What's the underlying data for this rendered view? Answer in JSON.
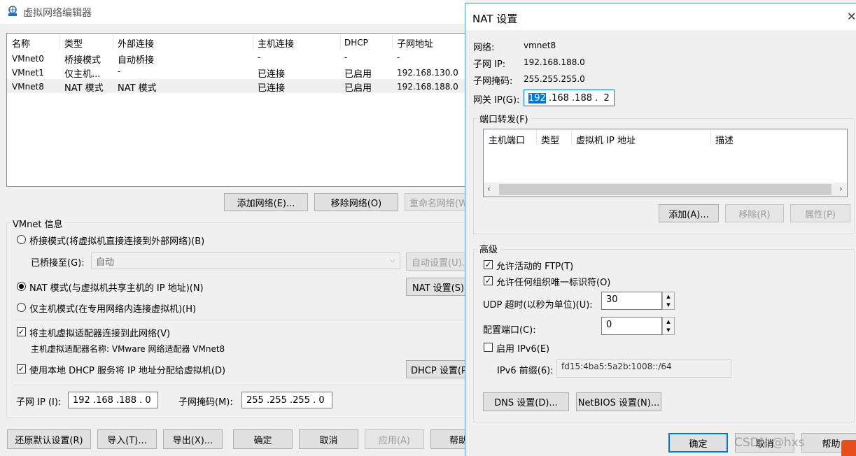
{
  "main_window": {
    "title": "虚拟网络编辑器",
    "table": {
      "columns": [
        "名称",
        "类型",
        "外部连接",
        "主机连接",
        "DHCP",
        "子网地址"
      ],
      "rows": [
        {
          "name": "VMnet0",
          "type": "桥接模式",
          "external": "自动桥接",
          "host": "-",
          "dhcp": "-",
          "subnet": "-"
        },
        {
          "name": "VMnet1",
          "type": "仅主机...",
          "external": "-",
          "host": "已连接",
          "dhcp": "已启用",
          "subnet": "192.168.130.0"
        },
        {
          "name": "VMnet8",
          "type": "NAT 模式",
          "external": "NAT 模式",
          "host": "已连接",
          "dhcp": "已启用",
          "subnet": "192.168.188.0"
        }
      ]
    },
    "buttons": {
      "add_network": "添加网络(E)...",
      "remove_network": "移除网络(O)",
      "rename_network": "重命名网络(W)..."
    },
    "vmnet_info": {
      "title": "VMnet 信息",
      "bridge_mode": "桥接模式(将虚拟机直接连接到外部网络)(B)",
      "bridged_to_label": "已桥接至(G):",
      "bridged_to_value": "自动",
      "auto_settings": "自动设置(U)...",
      "nat_mode": "NAT 模式(与虚拟机共享主机的 IP 地址)(N)",
      "nat_settings": "NAT 设置(S)...",
      "host_only": "仅主机模式(在专用网络内连接虚拟机)(H)",
      "connect_adapter": "将主机虚拟适配器连接到此网络(V)",
      "adapter_name": "主机虚拟适配器名称: VMware 网络适配器 VMnet8",
      "use_dhcp": "使用本地 DHCP 服务将 IP 地址分配给虚拟机(D)",
      "dhcp_settings": "DHCP 设置(P)...",
      "subnet_ip_label": "子网 IP (I):",
      "subnet_ip_value": "192 .168 .188 .  0",
      "subnet_mask_label": "子网掩码(M):",
      "subnet_mask_value": "255 .255 .255 .  0"
    },
    "bottom_buttons": {
      "restore": "还原默认设置(R)",
      "import": "导入(T)...",
      "export": "导出(X)...",
      "ok": "确定",
      "cancel": "取消",
      "apply": "应用(A)",
      "help": "帮助"
    }
  },
  "nat_dialog": {
    "title": "NAT 设置",
    "close": "✕",
    "network_label": "网络:",
    "network_value": "vmnet8",
    "subnet_ip_label": "子网 IP:",
    "subnet_ip_value": "192.168.188.0",
    "subnet_mask_label": "子网掩码:",
    "subnet_mask_value": "255.255.255.0",
    "gateway_label": "网关 IP(G):",
    "gateway_selected": "192",
    "gateway_rest": " .168 .188 .  2",
    "port_forwarding": {
      "title": "端口转发(F)",
      "columns": [
        "主机端口",
        "类型",
        "虚拟机 IP 地址",
        "描述"
      ],
      "add": "添加(A)...",
      "remove": "移除(R)",
      "properties": "属性(P)"
    },
    "advanced": {
      "title": "高级",
      "allow_ftp": "允许活动的 FTP(T)",
      "allow_uid": "允许任何组织唯一标识符(O)",
      "udp_timeout_label": "UDP 超时(以秒为单位)(U):",
      "udp_timeout_value": "30",
      "config_port_label": "配置端口(C):",
      "config_port_value": "0",
      "enable_ipv6": "启用 IPv6(E)",
      "ipv6_prefix_label": "IPv6 前缀(6):",
      "ipv6_prefix_value": "fd15:4ba5:5a2b:1008::/64",
      "dns_settings": "DNS 设置(D)...",
      "netbios_settings": "NetBIOS 设置(N)..."
    },
    "ok": "确定",
    "cancel": "取消",
    "help": "帮助"
  },
  "watermark": "CSDN @hxs",
  "colors": {
    "selection": "#0078d7",
    "accent_border": "#0078d7",
    "window_bg": "#f0f0f0"
  }
}
